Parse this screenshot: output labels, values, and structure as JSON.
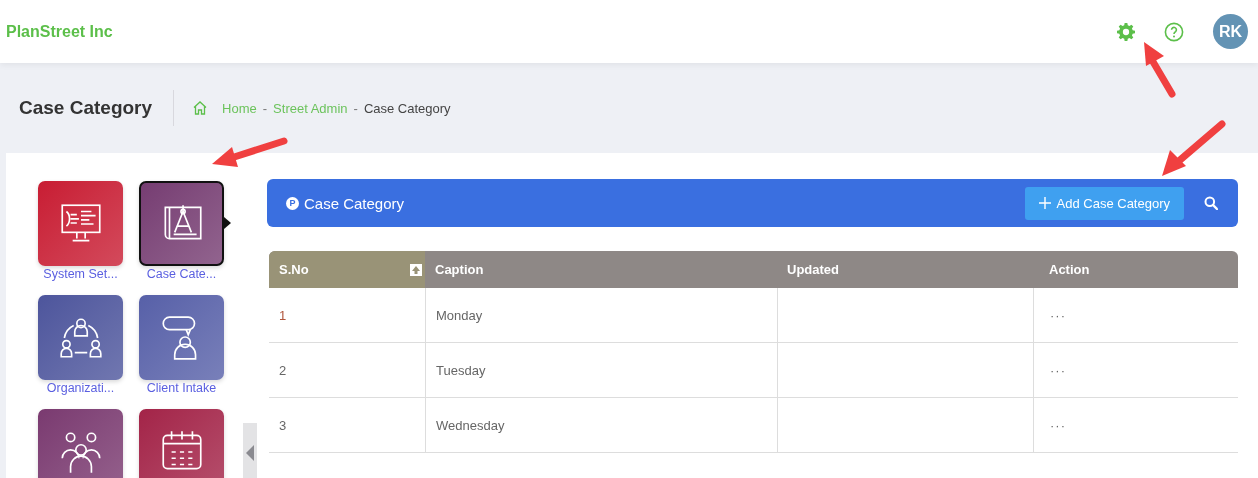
{
  "header": {
    "brand": "PlanStreet Inc",
    "avatar": "RK"
  },
  "page": {
    "title": "Case Category",
    "breadcrumb": [
      {
        "label": "Home",
        "kind": "link"
      },
      {
        "label": "Street Admin",
        "kind": "link"
      },
      {
        "label": "Case Category",
        "kind": "current"
      }
    ],
    "separator": "-"
  },
  "tiles": [
    {
      "label": "System Set...",
      "kind": "monitor",
      "color": "#c81d33",
      "selected": false
    },
    {
      "label": "Case Cate...",
      "kind": "blueprint",
      "color": "#763d72",
      "selected": true
    },
    {
      "label": "Organizati...",
      "kind": "cycle",
      "color": "#4d559c",
      "selected": false
    },
    {
      "label": "Client Intake",
      "kind": "chat",
      "color": "#5760a8",
      "selected": false
    },
    {
      "kind": "team",
      "color": "#7a3a70",
      "selected": false
    },
    {
      "kind": "calendar",
      "color": "#a32448",
      "selected": false
    }
  ],
  "panel": {
    "title": "Case Category",
    "badge": "P",
    "add_button": "Add Case Category"
  },
  "table": {
    "columns": [
      "S.No",
      "Caption",
      "Updated",
      "Action"
    ],
    "rows": [
      {
        "sno": "1",
        "caption": "Monday",
        "action": "···"
      },
      {
        "sno": "2",
        "caption": "Tuesday",
        "action": "···"
      },
      {
        "sno": "3",
        "caption": "Wednesday",
        "action": "···"
      }
    ]
  }
}
